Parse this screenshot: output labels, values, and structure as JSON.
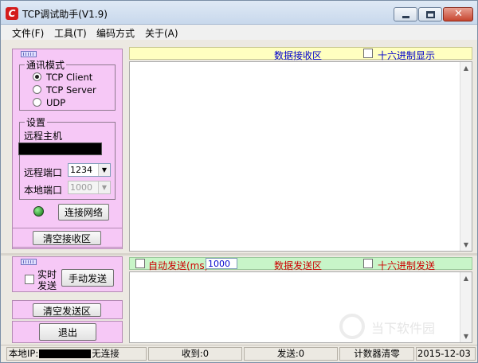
{
  "window": {
    "title": "TCP调试助手(V1.9)",
    "app_icon_letter": "C"
  },
  "menu": [
    "文件(F)",
    "工具(T)",
    "编码方式",
    "关于(A)"
  ],
  "comm_mode": {
    "title": "通讯模式",
    "options": [
      {
        "label": "TCP Client",
        "selected": true
      },
      {
        "label": "TCP Server",
        "selected": false
      },
      {
        "label": "UDP",
        "selected": false
      }
    ]
  },
  "settings": {
    "title": "设置",
    "remote_host_label": "远程主机",
    "remote_port_label": "远程端口",
    "remote_port_value": "1234",
    "local_port_label": "本地端口",
    "local_port_value": "1000"
  },
  "buttons": {
    "connect": "连接网络",
    "clear_recv": "清空接收区",
    "manual_send": "手动发送",
    "clear_send": "清空发送区",
    "exit": "退出"
  },
  "realtime_send": {
    "line1": "实时",
    "line2": "发送"
  },
  "recv": {
    "header": "数据接收区",
    "hex_display": "十六进制显示"
  },
  "send": {
    "auto_send": "自动发送(ms)",
    "interval": "1000",
    "header": "数据发送区",
    "hex_send": "十六进制发送"
  },
  "status": {
    "local_ip_label": "本地IP:",
    "connection": "无连接",
    "received": "收到:0",
    "sent": "发送:0",
    "counter_clear": "计数器清零",
    "date": "2015-12-03"
  },
  "watermark": "当下软件园",
  "colors": {
    "pink_panel": "#f6c8f6",
    "recv_header": "#ffffc0",
    "send_header": "#c8f5c8",
    "header_text_blue": "#0000cc",
    "header_text_red": "#cc0000",
    "led_green": "#1fa81f"
  }
}
